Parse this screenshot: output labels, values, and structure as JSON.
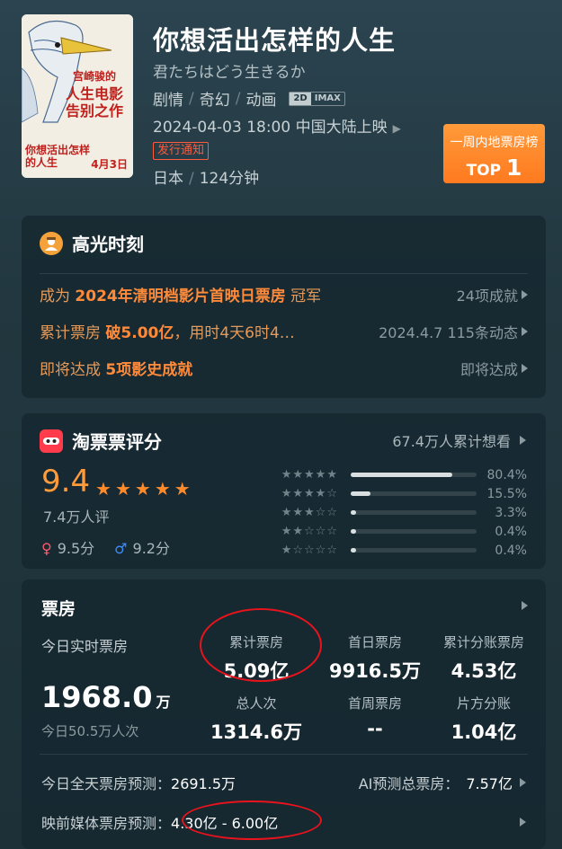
{
  "movie": {
    "title": "你想活出怎样的人生",
    "original_title": "君たちはどう生きるか",
    "genres": [
      "剧情",
      "奇幻",
      "动画"
    ],
    "format": [
      "2D",
      "IMAX"
    ],
    "release": "2024-04-03 18:00 中国大陆上映",
    "notice": "发行通知",
    "country": "日本",
    "duration": "124分钟",
    "poster": {
      "headline": [
        "宫崎骏的",
        "人生电影",
        "告别之作"
      ],
      "title_art": "你想活出怎样的人生",
      "date": "4月3日"
    }
  },
  "top_badge": {
    "line1": "一周内地票房榜",
    "prefix": "TOP",
    "rank": "1"
  },
  "highlights": {
    "title": "高光时刻",
    "rows": [
      {
        "prefix": "成为 ",
        "em": "2024年清明档影片首映日票房",
        "suffix": " 冠军",
        "right": "24项成就"
      },
      {
        "prefix": "累计票房 ",
        "em": "破5.00亿",
        "suffix": "，用时4天6时4…",
        "right": "2024.4.7 115条动态"
      },
      {
        "prefix": "即将达成 ",
        "em": "5项影史成就",
        "suffix": "",
        "right": "即将达成"
      }
    ]
  },
  "rating": {
    "title": "淘票票评分",
    "want_to_see": "67.4万人累计想看",
    "score": "9.4",
    "stars": 5,
    "raters": "7.4万人评",
    "female_score": "9.5分",
    "male_score": "9.2分",
    "distribution": [
      {
        "stars": 5,
        "percent": 80.4,
        "label": "80.4%"
      },
      {
        "stars": 4,
        "percent": 15.5,
        "label": "15.5%"
      },
      {
        "stars": 3,
        "percent": 3.3,
        "label": "3.3%"
      },
      {
        "stars": 2,
        "percent": 0.4,
        "label": "0.4%"
      },
      {
        "stars": 1,
        "percent": 0.4,
        "label": "0.4%"
      }
    ]
  },
  "box_office": {
    "title": "票房",
    "today_label": "今日实时票房",
    "today_value": "1968.0",
    "today_unit": "万",
    "today_viewers": "今日50.5万人次",
    "cells": {
      "total": {
        "label": "累计票房",
        "value": "5.09亿"
      },
      "first_day": {
        "label": "首日票房",
        "value": "9916.5万"
      },
      "split": {
        "label": "累计分账票房",
        "value": "4.53亿"
      },
      "viewers": {
        "label": "总人次",
        "value": "1314.6万"
      },
      "first_week": {
        "label": "首周票房",
        "value": "--"
      },
      "per_film": {
        "label": "片方分账",
        "value": "1.04亿"
      }
    },
    "forecast_today_label": "今日全天票房预测：",
    "forecast_today_value": "2691.5万",
    "ai_label": "AI预测总票房：",
    "ai_value": "7.57亿",
    "media_label": "映前媒体票房预测：",
    "media_value": "4.30亿 - 6.00亿"
  },
  "colors": {
    "accent_orange": "#ff8a3a",
    "annotation_red": "#e8131c",
    "taopiaopiao_red": "#ff3b4c",
    "female": "#ff5a6e",
    "male": "#3e8cff"
  }
}
